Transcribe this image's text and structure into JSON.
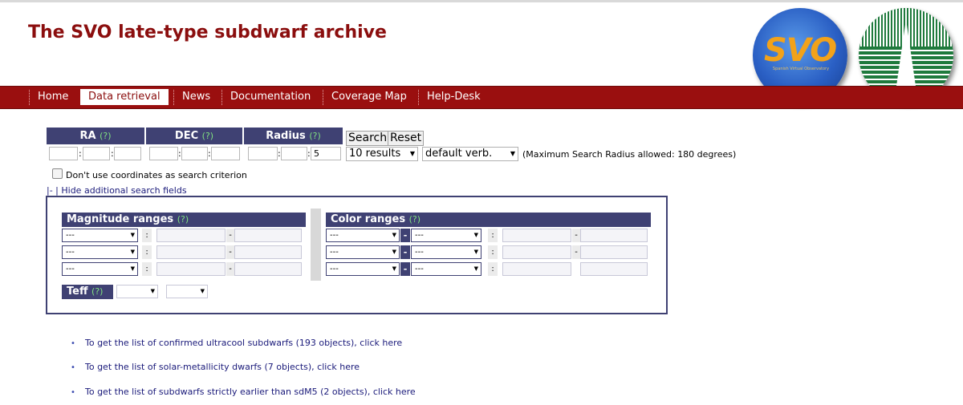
{
  "header": {
    "title": "The SVO late-type subdwarf archive"
  },
  "nav": {
    "items": [
      {
        "label": "Home",
        "active": false
      },
      {
        "label": "Data retrieval",
        "active": true
      },
      {
        "label": "News",
        "active": false
      },
      {
        "label": "Documentation",
        "active": false
      },
      {
        "label": "Coverage Map",
        "active": false
      },
      {
        "label": "Help-Desk",
        "active": false
      }
    ]
  },
  "logos": {
    "svo_text": "SVO",
    "svo_subtext": "Spanish Virtual Observatory"
  },
  "search": {
    "ra_label": "RA",
    "dec_label": "DEC",
    "radius_label": "Radius",
    "help": "(?)",
    "radius_value": "5",
    "search_button": "Search",
    "reset_button": "Reset",
    "results_select": "10 results",
    "verb_select": "default verb.",
    "max_radius_note": "(Maximum Search Radius allowed: 180 degrees)",
    "no_coords_label": "Don't use coordinates as search criterion",
    "hide_fields_link": "|- | Hide additional search fields"
  },
  "additional": {
    "magnitude_label": "Magnitude ranges",
    "color_label": "Color ranges",
    "teff_label": "Teff",
    "help": "(?)",
    "select_value": "---",
    "colon": ":",
    "dash": "-"
  },
  "links": [
    "To get the list of confirmed ultracool subdwarfs (193 objects), click here",
    "To get the list of solar-metallicity dwarfs (7 objects), click here",
    "To get the list of subdwarfs strictly earlier than sdM5 (2 objects), click here"
  ],
  "colors": {
    "brand_red": "#9a0f0f",
    "title_red": "#8b0e0e",
    "header_navy": "#3f4173",
    "help_green": "#7fe080",
    "link_blue": "#1a1a7a"
  },
  "icons": {
    "dropdown": "chevron-down-icon",
    "checkbox": "checkbox-icon",
    "bullet": "bullet-icon"
  }
}
